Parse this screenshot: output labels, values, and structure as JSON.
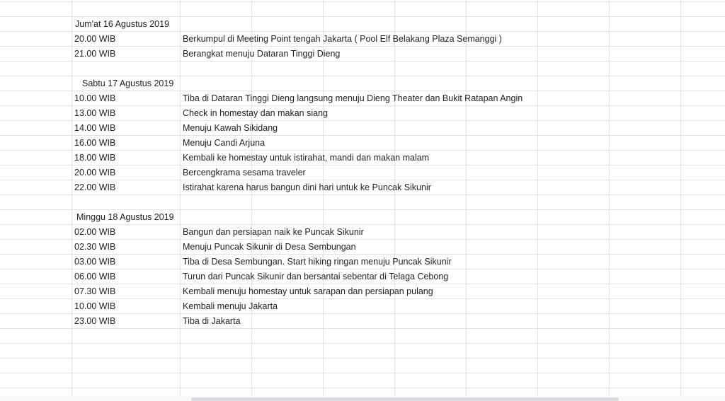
{
  "days": [
    {
      "date": "Jum'at 16 Agustus 2019",
      "items": [
        {
          "time": "20.00 WIB",
          "activity": "Berkumpul di Meeting Point tengah Jakarta ( Pool Elf Belakang Plaza Semanggi )"
        },
        {
          "time": "21.00 WIB",
          "activity": "Berangkat menuju Dataran Tinggi Dieng"
        }
      ]
    },
    {
      "date": "Sabtu 17 Agustus 2019",
      "items": [
        {
          "time": "10.00 WIB",
          "activity": "Tiba di Dataran Tinggi Dieng langsung menuju Dieng Theater dan Bukit Ratapan Angin"
        },
        {
          "time": "13.00 WIB",
          "activity": "Check in homestay dan makan siang"
        },
        {
          "time": "14.00 WIB",
          "activity": "Menuju Kawah Sikidang"
        },
        {
          "time": "16.00 WIB",
          "activity": "Menuju Candi Arjuna"
        },
        {
          "time": "18.00 WIB",
          "activity": "Kembali ke homestay untuk istirahat, mandi dan makan malam"
        },
        {
          "time": "20.00 WIB",
          "activity": "Bercengkrama sesama traveler"
        },
        {
          "time": "22.00 WIB",
          "activity": "Istirahat karena harus bangun dini hari untuk ke Puncak Sikunir"
        }
      ]
    },
    {
      "date": "Minggu 18 Agustus 2019",
      "items": [
        {
          "time": "02.00 WIB",
          "activity": "Bangun dan persiapan naik ke Puncak Sikunir"
        },
        {
          "time": "02.30 WIB",
          "activity": "Menuju Puncak Sikunir di Desa Sembungan"
        },
        {
          "time": "03.00 WIB",
          "activity": "Tiba di Desa Sembungan. Start hiking ringan menuju Puncak Sikunir"
        },
        {
          "time": "06.00 WIB",
          "activity": "Turun dari Puncak Sikunir dan bersantai sebentar di Telaga Cebong"
        },
        {
          "time": "07.30 WIB",
          "activity": "Kembali menuju homestay untuk sarapan dan persiapan pulang"
        },
        {
          "time": "10.00 WIB",
          "activity": "Kembali menuju Jakarta"
        },
        {
          "time": "23.00 WIB",
          "activity": "Tiba di Jakarta"
        }
      ]
    }
  ]
}
